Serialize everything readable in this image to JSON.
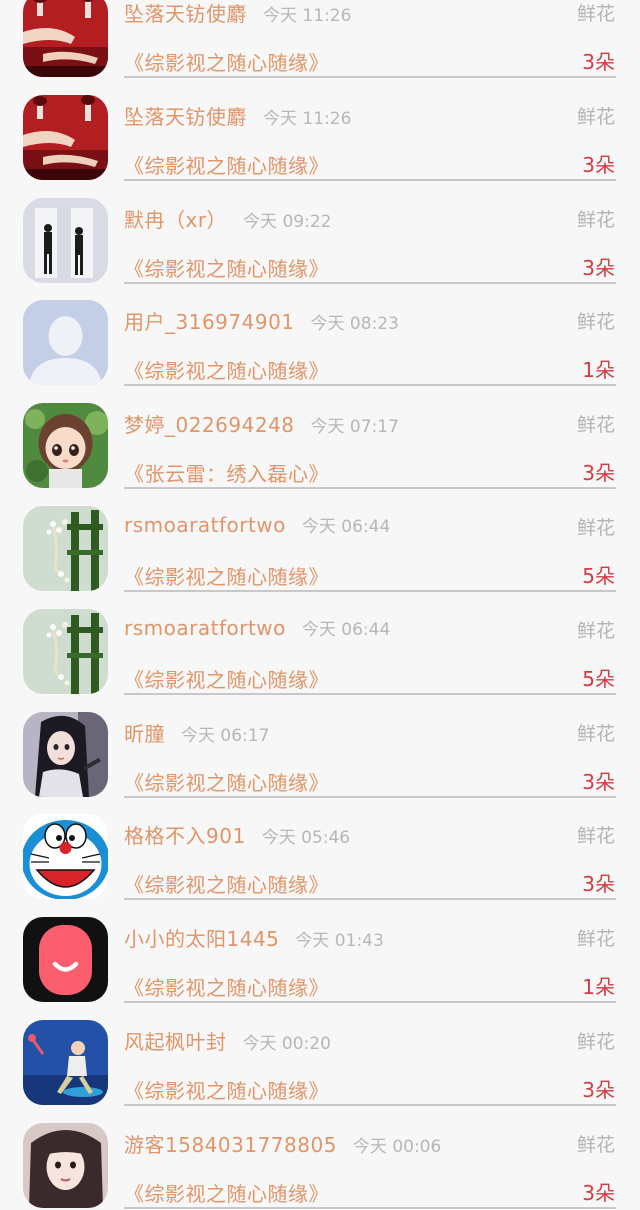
{
  "rows": [
    {
      "name": "坠落天钫使麝",
      "time": "今天 11:26",
      "kind": "鲜花",
      "book": "《综影视之随心随缘》",
      "count": "3朵",
      "avatar": "red-hands-avatar"
    },
    {
      "name": "坠落天钫使麝",
      "time": "今天 11:26",
      "kind": "鲜花",
      "book": "《综影视之随心随缘》",
      "count": "3朵",
      "avatar": "red-hands-avatar"
    },
    {
      "name": "默冉（xr）",
      "time": "今天 09:22",
      "kind": "鲜花",
      "book": "《综影视之随心随缘》",
      "count": "3朵",
      "avatar": "couple-photo-avatar"
    },
    {
      "name": "用户_316974901",
      "time": "今天 08:23",
      "kind": "鲜花",
      "book": "《综影视之随心随缘》",
      "count": "1朵",
      "avatar": "default-user-avatar"
    },
    {
      "name": "梦婷_022694248",
      "time": "今天 07:17",
      "kind": "鲜花",
      "book": "《张云雷：绣入磊心》",
      "count": "3朵",
      "avatar": "anime-girl-avatar"
    },
    {
      "name": "rsmoaratfortwo",
      "time": "今天 06:44",
      "kind": "鲜花",
      "book": "《综影视之随心随缘》",
      "count": "5朵",
      "avatar": "chair-flowers-avatar"
    },
    {
      "name": "rsmoaratfortwo",
      "time": "今天 06:44",
      "kind": "鲜花",
      "book": "《综影视之随心随缘》",
      "count": "5朵",
      "avatar": "chair-flowers-avatar"
    },
    {
      "name": "昕朣",
      "time": "今天 06:17",
      "kind": "鲜花",
      "book": "《综影视之随心随缘》",
      "count": "3朵",
      "avatar": "dark-hair-girl-avatar"
    },
    {
      "name": "格格不入901",
      "time": "今天 05:46",
      "kind": "鲜花",
      "book": "《综影视之随心随缘》",
      "count": "3朵",
      "avatar": "doraemon-avatar"
    },
    {
      "name": "小小的太阳1445",
      "time": "今天 01:43",
      "kind": "鲜花",
      "book": "《综影视之随心随缘》",
      "count": "1朵",
      "avatar": "smile-app-avatar"
    },
    {
      "name": "风起枫叶封",
      "time": "今天 00:20",
      "kind": "鲜花",
      "book": "《综影视之随心随缘》",
      "count": "3朵",
      "avatar": "blue-figure-avatar"
    },
    {
      "name": "游客1584031778805",
      "time": "今天 00:06",
      "kind": "鲜花",
      "book": "《综影视之随心随缘》",
      "count": "3朵",
      "avatar": "selfie-girl-avatar"
    }
  ]
}
